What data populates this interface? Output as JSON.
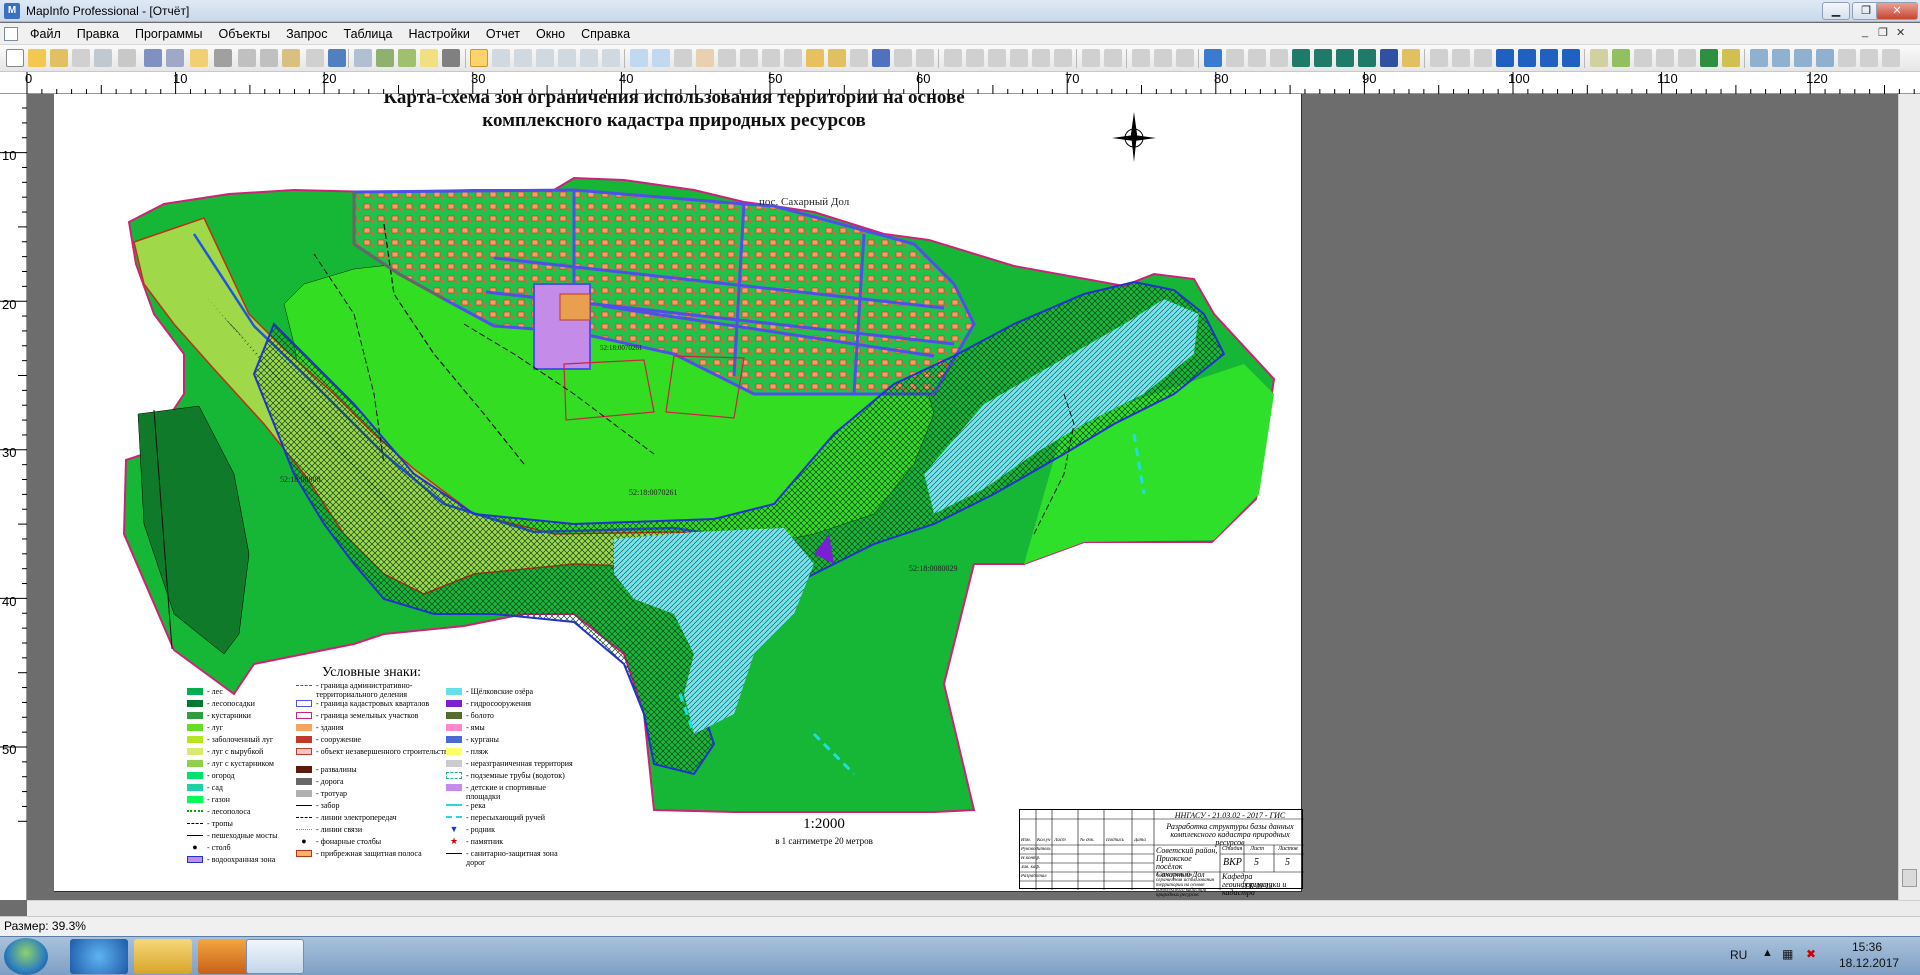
{
  "window": {
    "title": "MapInfo Professional - [Отчёт]",
    "minimize": "▁",
    "restore": "❐",
    "close": "✕"
  },
  "menu": {
    "items": [
      "Файл",
      "Правка",
      "Программы",
      "Объекты",
      "Запрос",
      "Таблица",
      "Настройки",
      "Отчет",
      "Окно",
      "Справка"
    ],
    "mdi_min": "_",
    "mdi_restore": "❐",
    "mdi_close": "✕"
  },
  "ruler": {
    "h_labels": [
      "0",
      "10",
      "20",
      "30",
      "40",
      "50",
      "60",
      "70",
      "80",
      "90",
      "100",
      "110",
      "120"
    ],
    "v_labels": [
      "10",
      "20",
      "30",
      "40",
      "50"
    ]
  },
  "map": {
    "title_line1": "Карта-схема зон ограничения использования территории на основе",
    "title_line2": "комплексного кадастра природных ресурсов",
    "compass": "N",
    "settlement": "пос. Сахарный Дол",
    "cadastral_labels": [
      "52:18:0070261",
      "52:18:0070261",
      "52:18:0080029",
      "52:18:00800"
    ],
    "scale": "1:2000",
    "scale_note": "в 1 сантиметре 20 метров",
    "legend_title": "Условные знаки:",
    "legend_col1": [
      "- лес",
      "- лесопосадки",
      "- кустарники",
      "- луг",
      "- заболоченный луг",
      "- луг с вырубкой",
      "- луг с кустарником",
      "- огород",
      "- сад",
      "- газон",
      "- лесополоса",
      "- тропы",
      "- пешеходные мосты",
      "- столб",
      "- водоохранная зона"
    ],
    "legend_col2": [
      "- граница административно-территориального деления",
      "- граница кадастровых кварталов",
      "- граница земельных участков",
      "- здания",
      "- сооружение",
      "- объект незавершенного строительства",
      "- развалины",
      "- дорога",
      "- тротуар",
      "- забор",
      "- линии электропередач",
      "- линии связи",
      "- фонарные столбы",
      "- прибрежная защитная полоса"
    ],
    "legend_col3": [
      "- Щёлковские озёра",
      "- гидросооружения",
      "- болото",
      "- ямы",
      "- курганы",
      "- пляж",
      "- неразграниченная территория",
      "- подземные трубы (водоток)",
      "- детские и спортивные площадки",
      "- река",
      "- пересыхающий ручей",
      "- родник",
      "- памятник",
      "- санитарно-защитная зона дорог"
    ],
    "legend_colors": {
      "forest": "#00b050",
      "plantings": "#007a33",
      "shrubs": "#2e9e3e",
      "meadow": "#66dd22",
      "wet_meadow": "#b5e61d",
      "clearing": "#d9ea6e",
      "meadow_shrub": "#8ed04a",
      "garden": "#00e070",
      "orchard": "#1fd1a0",
      "lawn": "#00ff55",
      "building": "#f4a460",
      "structure": "#c0392b",
      "lake": "#66e0e8",
      "hydro": "#7a1fd1",
      "bog": "#556b2f",
      "pits": "#ff88cc",
      "kurgan": "#4b6ad1",
      "beach": "#ffff66",
      "undelimited": "#cccccc",
      "playground": "#c58be8"
    }
  },
  "stamp": {
    "org": "ННГАСУ - 21.03.02 - 2017 - ГИС",
    "subject": "Разработка структуры базы данных комплексного кадастра природных ресурсов",
    "place": "Советский район, Приокское посёлок Сахарный Дол",
    "stage_label": "Стадия",
    "sheet_label": "Лист",
    "sheets_label": "Листов",
    "stage": "ВКР",
    "sheet": "5",
    "sheets": "5",
    "sheet_title": "Карта-схема зон ограничения использования территории на основе комплексного кадастра природных ресурсов",
    "dept": "Кафедра геоинформатики и кадастра",
    "group": "ГК-39-13",
    "roles": [
      "Изм.",
      "Кол.уч",
      "Лист",
      "№ док.",
      "Подпись",
      "Дата"
    ],
    "role_rows": [
      "Руководитель",
      "Н.контр.",
      "Зав. каф.",
      "Разработал"
    ]
  },
  "status": {
    "size": "Размер: 39.3%"
  },
  "tray": {
    "lang": "RU",
    "time": "15:36",
    "date": "18.12.2017"
  }
}
